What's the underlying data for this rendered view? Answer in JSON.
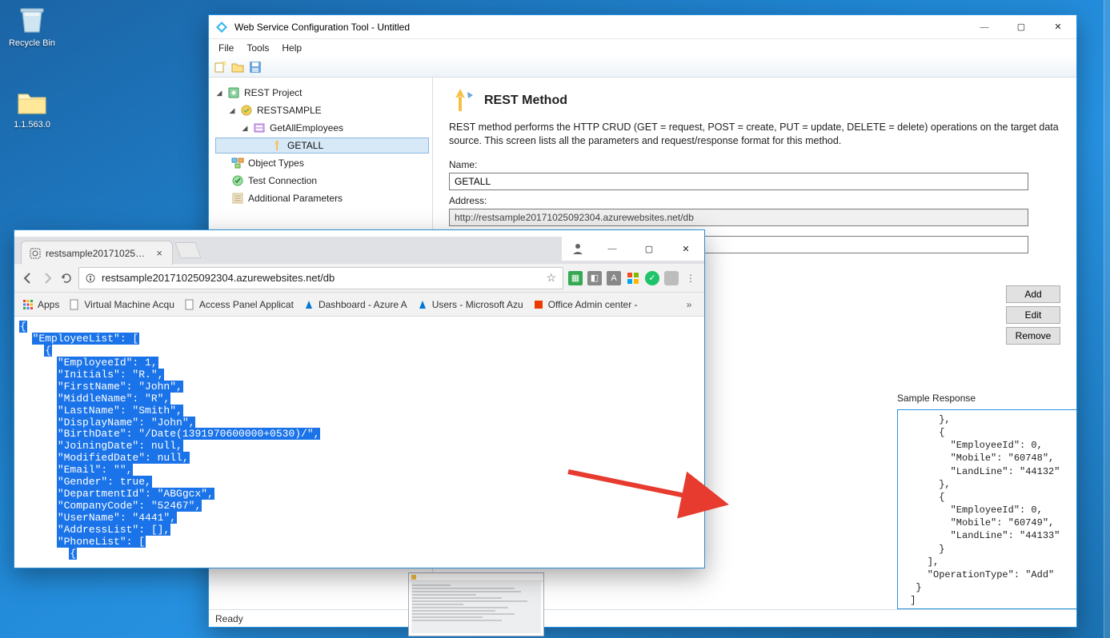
{
  "desktop": {
    "recycle_bin": "Recycle Bin",
    "folder_label": "1.1.563.0"
  },
  "config_window": {
    "title": "Web Service Configuration Tool - Untitled",
    "menus": {
      "file": "File",
      "tools": "Tools",
      "help": "Help"
    },
    "tree": {
      "root": "REST Project",
      "service": "RESTSAMPLE",
      "method_group": "GetAllEmployees",
      "method": "GETALL",
      "object_types": "Object Types",
      "test_connection": "Test Connection",
      "additional_params": "Additional Parameters"
    },
    "section": {
      "title": "REST Method",
      "desc": "REST method performs the HTTP CRUD (GET = request, POST = create, PUT = update, DELETE = delete) operations on the target data source. This screen lists all the parameters and request/response format for this method.",
      "name_label": "Name:",
      "name_value": "GETALL",
      "address_label": "Address:",
      "address_value": "http://restsample20171025092304.azurewebsites.net/db",
      "sample_response_label": "Sample Response",
      "buttons": {
        "add": "Add",
        "edit": "Edit",
        "remove": "Remove"
      },
      "sample_response_text": "      },\n      {\n        \"EmployeeId\": 0,\n        \"Mobile\": \"60748\",\n        \"LandLine\": \"44132\"\n      },\n      {\n        \"EmployeeId\": 0,\n        \"Mobile\": \"60749\",\n        \"LandLine\": \"44133\"\n      }\n    ],\n    \"OperationType\": \"Add\"\n  }\n ]\n}]"
    },
    "status": "Ready"
  },
  "browser": {
    "tab_title": "restsample20171025092…",
    "url_display": "restsample20171025092304.azurewebsites.net/db",
    "bookmarks": {
      "apps": "Apps",
      "vm": "Virtual Machine Acqu",
      "access": "Access Panel Applicat",
      "azure_dash": "Dashboard - Azure A",
      "users": "Users - Microsoft Azu",
      "office": "Office Admin center -"
    },
    "json_lines": [
      "{",
      "  \"EmployeeList\": [",
      "    {",
      "      \"EmployeeId\": 1,",
      "      \"Initials\": \"R.\",",
      "      \"FirstName\": \"John\",",
      "      \"MiddleName\": \"R\",",
      "      \"LastName\": \"Smith\",",
      "      \"DisplayName\": \"John\",",
      "      \"BirthDate\": \"/Date(1391970600000+0530)/\",",
      "      \"JoiningDate\": null,",
      "      \"ModifiedDate\": null,",
      "      \"Email\": \"\",",
      "      \"Gender\": true,",
      "      \"DepartmentId\": \"ABGgcx\",",
      "      \"CompanyCode\": \"52467\",",
      "      \"UserName\": \"4441\",",
      "      \"AddressList\": [],",
      "      \"PhoneList\": [",
      "        {"
    ]
  }
}
